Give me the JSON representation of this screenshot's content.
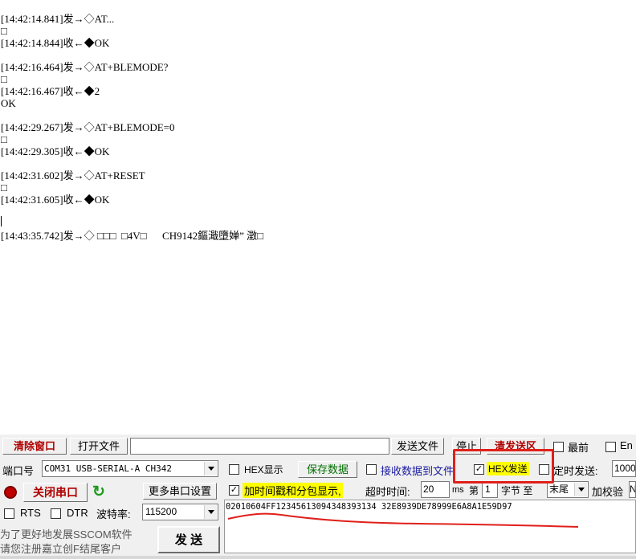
{
  "log": {
    "lines": [
      "[14:42:14.841]发→◇AT...",
      "□",
      "[14:42:14.844]收←◆OK",
      "",
      "[14:42:16.464]发→◇AT+BLEMODE?",
      "□",
      "[14:42:16.467]收←◆2",
      "OK",
      "",
      "[14:42:29.267]发→◇AT+BLEMODE=0",
      "□",
      "[14:42:29.305]收←◆OK",
      "",
      "[14:42:31.602]发→◇AT+RESET",
      "□",
      "[14:42:31.605]收←◆OK",
      "",
      "",
      "[14:43:35.742]发→◇ □□□  □4V□      CH9142鏂濈墮婵” 澂□"
    ]
  },
  "toolbar": {
    "clear_window": "清除窗口",
    "open_file": "打开文件",
    "file_path": "",
    "send_file": "发送文件",
    "stop": "停止",
    "clear_send": "清发送区",
    "last_label": "最前",
    "en_label": "En"
  },
  "port": {
    "label": "端口号",
    "value": "COM31 USB-SERIAL-A CH342",
    "close_port": "关闭串口",
    "more_settings": "更多串口设置",
    "rts": "RTS",
    "dtr": "DTR",
    "baud_label": "波特率:",
    "baud_value": "115200"
  },
  "options": {
    "hex_display": "HEX显示",
    "save_data": "保存数据",
    "recv_to_file": "接收数据到文件",
    "hex_send": "HEX发送",
    "timed_send": "定时发送:",
    "timed_value": "1000",
    "timestamp": "加时间戳和分包显示,",
    "timeout_label": "超时时间:",
    "timeout_value": "20",
    "ms": "ms",
    "di": "第",
    "byte_no": "1",
    "byte_label": "字节 至",
    "end_option": "末尾",
    "checksum": "加校验",
    "checksum_value": "N"
  },
  "send": {
    "text": "02010604FF12345613094348393134 32E8939DE78999E6A8A1E59D97",
    "button": "发 送"
  },
  "promo": {
    "line1": "为了更好地发展SSCOM软件",
    "line2": "请您注册嘉立创F结尾客户"
  },
  "colors": {
    "highlight_box": "#e0201b",
    "annotation_line": "#e0201b",
    "yellow": "#ffff00"
  }
}
